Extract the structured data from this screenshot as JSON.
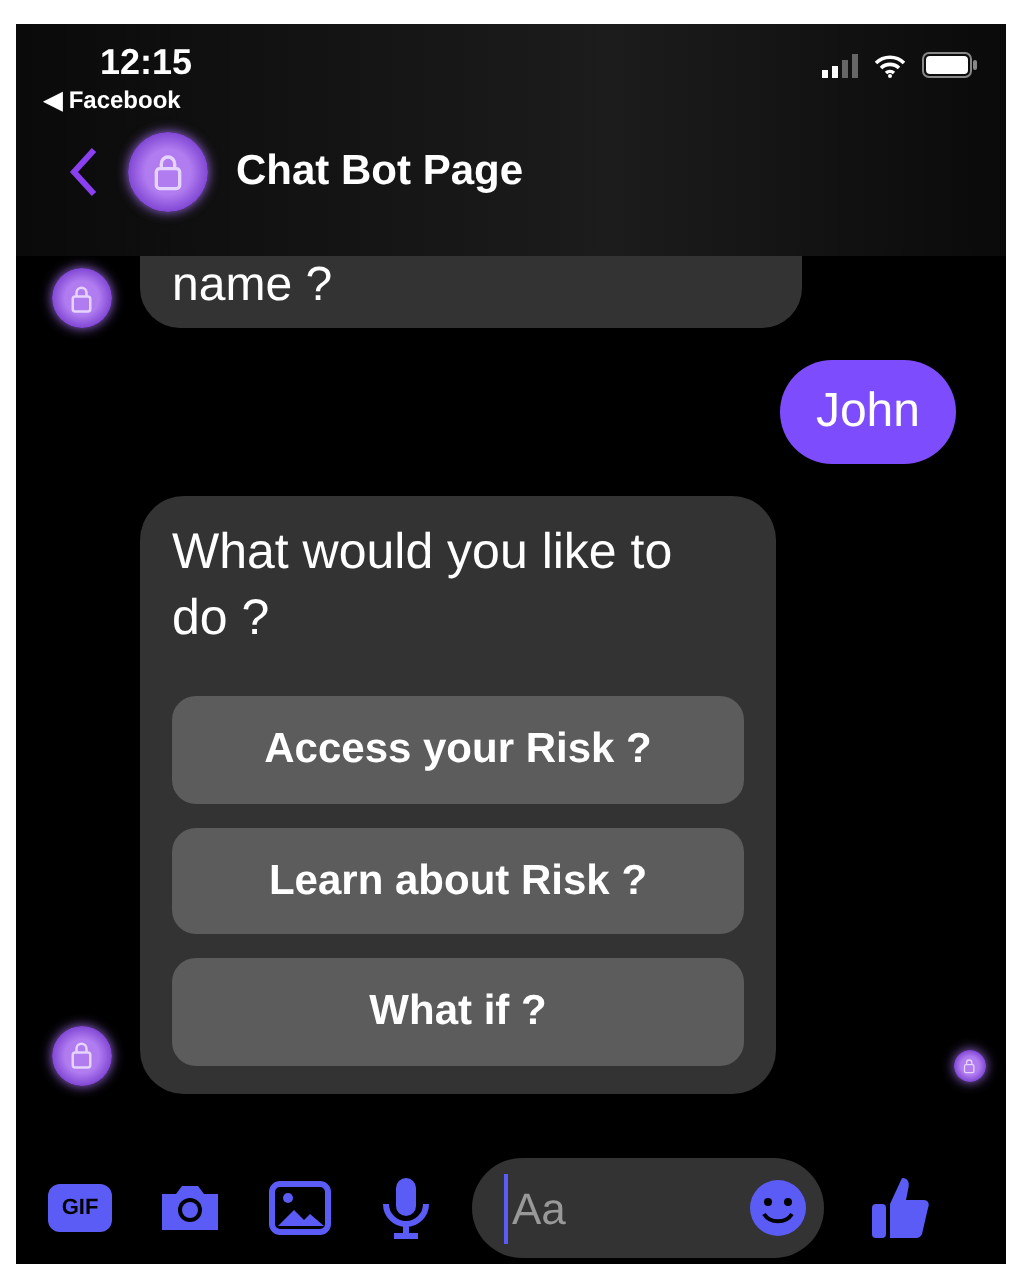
{
  "status_bar": {
    "time": "12:15",
    "back_app": "◀ Facebook"
  },
  "header": {
    "title": "Chat Bot Page"
  },
  "messages": [
    {
      "kind": "bot_text",
      "text": "name ?",
      "avatar": true
    },
    {
      "kind": "user_text",
      "text": "John"
    },
    {
      "kind": "bot_card",
      "text": "What would you like to do ?",
      "buttons": [
        "Access your Risk ?",
        "Learn about Risk ?",
        "What if ?"
      ],
      "avatar": true,
      "seen": true
    }
  ],
  "composer": {
    "gif_label": "GIF",
    "placeholder": "Aa"
  }
}
